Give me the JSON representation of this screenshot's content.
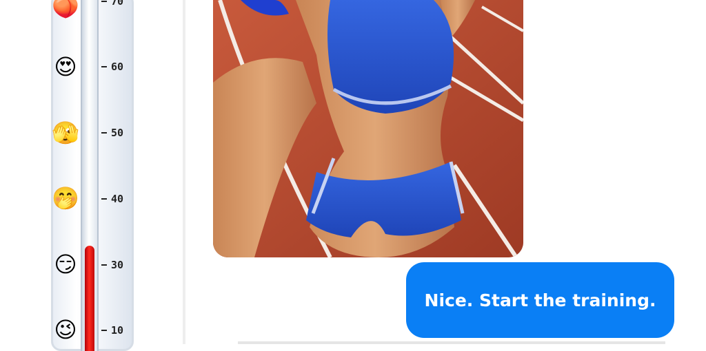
{
  "thermometer": {
    "level": 33,
    "level_unit": "scale units",
    "ticks": [
      {
        "label": "70"
      },
      {
        "label": "60"
      },
      {
        "label": "50"
      },
      {
        "label": "40"
      },
      {
        "label": "30"
      },
      {
        "label": "10"
      }
    ],
    "emojis": [
      {
        "icon": "peach-icon",
        "glyph": "🍑"
      },
      {
        "icon": "heart-eyes-icon",
        "glyph": "😍"
      },
      {
        "icon": "face-peeking-icon",
        "glyph": "🫣"
      },
      {
        "icon": "hand-over-mouth-icon",
        "glyph": "🤭"
      },
      {
        "icon": "smirk-icon",
        "glyph": "😏"
      },
      {
        "icon": "wink-icon",
        "glyph": "😉"
      }
    ],
    "fill_color": "#e3120b"
  },
  "chat": {
    "photo": {
      "icon": "photo-image",
      "description_colors": {
        "track": "#b54a32",
        "outfit": "#2f5bd6"
      }
    },
    "message": {
      "text": "Nice. Start the training.",
      "color": "#0a7ff5"
    }
  }
}
